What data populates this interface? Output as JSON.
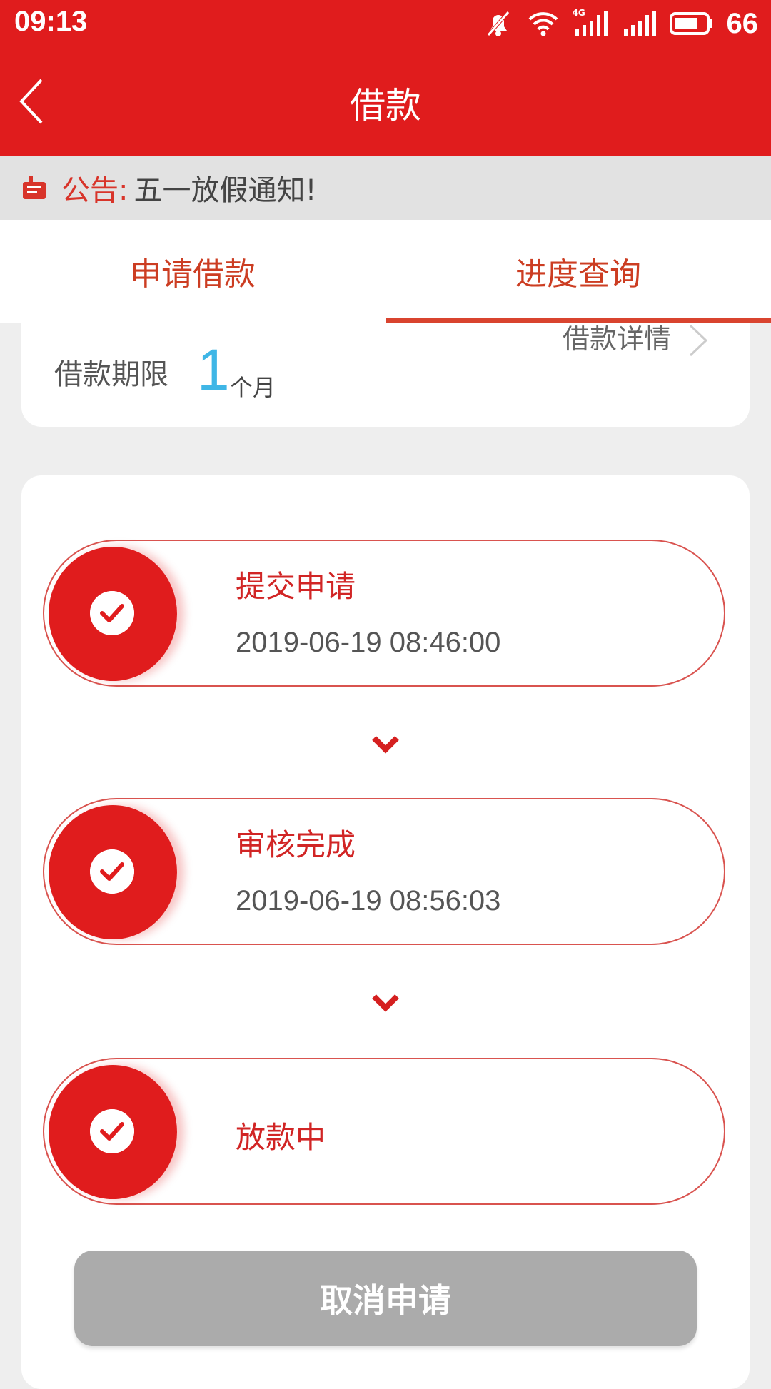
{
  "status_bar": {
    "time": "09:13",
    "battery_level": "66",
    "network_label": "4G",
    "icons": [
      "bell-muted-icon",
      "wifi-icon",
      "signal-4g-icon",
      "signal-icon",
      "battery-icon"
    ]
  },
  "header": {
    "title": "借款",
    "back_icon": "chevron-left-icon"
  },
  "notice": {
    "label": "公告:",
    "text": "五一放假通知!"
  },
  "tabs": [
    {
      "label": "申请借款",
      "active": false
    },
    {
      "label": "进度查询",
      "active": true
    }
  ],
  "loan_summary": {
    "detail_link": "借款详情",
    "term_label": "借款期限",
    "term_value": "1",
    "term_unit": "个月"
  },
  "progress": [
    {
      "title": "提交申请",
      "time": "2019-06-19 08:46:00",
      "done": true
    },
    {
      "title": "审核完成",
      "time": "2019-06-19 08:56:03",
      "done": true
    },
    {
      "title": "放款中",
      "time": "",
      "done": true
    }
  ],
  "actions": {
    "cancel_label": "取消申请"
  },
  "colors": {
    "brand_red": "#e01c1d",
    "tab_text": "#cc3d22",
    "term_blue": "#3fb6e6",
    "disabled_gray": "#ababab"
  }
}
